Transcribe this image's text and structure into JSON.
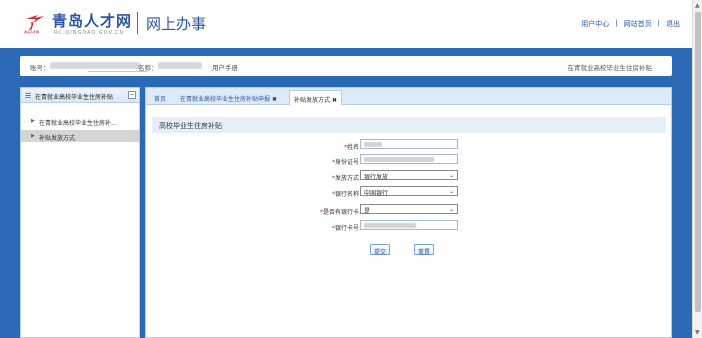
{
  "header": {
    "logo_name": "青岛人才网",
    "logo_domain": "RC.QINGDAO.GOV.CN",
    "logo_mark_caption": "青岛人才网",
    "subtitle": "网上办事",
    "links": [
      "用户中心",
      "网站首页",
      "退出"
    ],
    "separator": "|",
    "brand_color": "#2f55a4"
  },
  "infobar": {
    "account_label": "账号：",
    "name_label": "名称：",
    "manual_link": "用户手册",
    "right_text": "在青就业高校毕业生住房补贴"
  },
  "sidebar": {
    "title": "在青就业高校毕业生住房补贴",
    "collapse_symbol": "−",
    "items": [
      {
        "label": "在青就业高校毕业生住房补...",
        "selected": false
      },
      {
        "label": "补贴发放方式",
        "selected": true
      }
    ]
  },
  "tabs": [
    {
      "label": "首页",
      "closable": false,
      "active": false
    },
    {
      "label": "在青就业高校毕业生住房补贴申报",
      "closable": true,
      "active": false
    },
    {
      "label": "补贴发放方式",
      "closable": true,
      "active": true
    }
  ],
  "form": {
    "section_title": "高校毕业生住房补贴",
    "fields": [
      {
        "label": "姓名",
        "required": true,
        "type": "text",
        "value": ""
      },
      {
        "label": "身份证号",
        "required": true,
        "type": "text",
        "value": ""
      },
      {
        "label": "发放方式",
        "required": true,
        "type": "select",
        "value": "银行发放"
      },
      {
        "label": "银行名称",
        "required": true,
        "type": "select",
        "value": "中国银行"
      },
      {
        "label": "是否有银行卡",
        "required": true,
        "type": "select",
        "value": "是"
      },
      {
        "label": "银行卡号",
        "required": true,
        "type": "text",
        "value": ""
      }
    ],
    "submit_label": "提交",
    "reset_label": "重置"
  },
  "colors": {
    "background": "#2d6ab5",
    "required_mark": "#e01a1a",
    "section_bg": "#e6eff9"
  },
  "icons": [
    "logo-mark-icon",
    "menu-icon",
    "collapse-icon",
    "arrow-right-icon",
    "close-icon",
    "chevron-down-icon",
    "scroll-up-icon",
    "scroll-down-icon"
  ]
}
